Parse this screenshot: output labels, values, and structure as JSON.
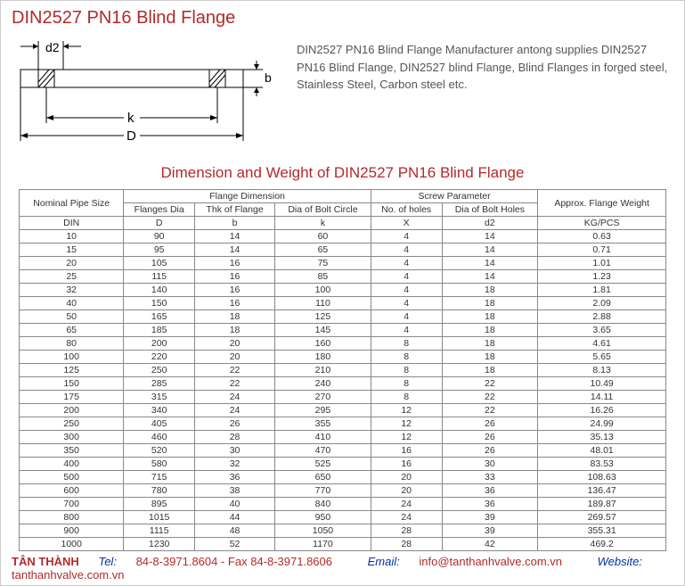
{
  "title": "DIN2527 PN16 Blind Flange",
  "description": "DIN2527 PN16 Blind Flange Manufacturer antong supplies DIN2527 PN16 Blind Flange, DIN2527 blind Flange, Blind Flanges in forged steel, Stainless Steel, Carbon steel etc.",
  "subheading": "Dimension and Weight of DIN2527 PN16 Blind Flange",
  "diagram": {
    "d2": "d2",
    "b": "b",
    "k": "k",
    "D": "D"
  },
  "table": {
    "hdr_npsize": "Nominal Pipe Size",
    "hdr_flangedim": "Flange Dimension",
    "hdr_screw": "Screw Parameter",
    "hdr_weight": "Approx. Flange Weight",
    "hdr_fdia": "Flanges Dia",
    "hdr_thk": "Thk of Flange",
    "hdr_boltcircle": "Dia of Bolt Circle",
    "hdr_noholes": "No. of holes",
    "hdr_diabolt": "Dia of Bolt Holes",
    "hdr_din": "DIN",
    "hdr_D": "D",
    "hdr_b": "b",
    "hdr_k": "k",
    "hdr_X": "X",
    "hdr_d2": "d2",
    "hdr_kgpcs": "KG/PCS",
    "rows": [
      [
        "10",
        "90",
        "14",
        "60",
        "4",
        "14",
        "0.63"
      ],
      [
        "15",
        "95",
        "14",
        "65",
        "4",
        "14",
        "0.71"
      ],
      [
        "20",
        "105",
        "16",
        "75",
        "4",
        "14",
        "1.01"
      ],
      [
        "25",
        "115",
        "16",
        "85",
        "4",
        "14",
        "1.23"
      ],
      [
        "32",
        "140",
        "16",
        "100",
        "4",
        "18",
        "1.81"
      ],
      [
        "40",
        "150",
        "16",
        "110",
        "4",
        "18",
        "2.09"
      ],
      [
        "50",
        "165",
        "18",
        "125",
        "4",
        "18",
        "2.88"
      ],
      [
        "65",
        "185",
        "18",
        "145",
        "4",
        "18",
        "3.65"
      ],
      [
        "80",
        "200",
        "20",
        "160",
        "8",
        "18",
        "4.61"
      ],
      [
        "100",
        "220",
        "20",
        "180",
        "8",
        "18",
        "5.65"
      ],
      [
        "125",
        "250",
        "22",
        "210",
        "8",
        "18",
        "8.13"
      ],
      [
        "150",
        "285",
        "22",
        "240",
        "8",
        "22",
        "10.49"
      ],
      [
        "175",
        "315",
        "24",
        "270",
        "8",
        "22",
        "14.11"
      ],
      [
        "200",
        "340",
        "24",
        "295",
        "12",
        "22",
        "16.26"
      ],
      [
        "250",
        "405",
        "26",
        "355",
        "12",
        "26",
        "24.99"
      ],
      [
        "300",
        "460",
        "28",
        "410",
        "12",
        "26",
        "35.13"
      ],
      [
        "350",
        "520",
        "30",
        "470",
        "16",
        "26",
        "48.01"
      ],
      [
        "400",
        "580",
        "32",
        "525",
        "16",
        "30",
        "83.53"
      ],
      [
        "500",
        "715",
        "36",
        "650",
        "20",
        "33",
        "108.63"
      ],
      [
        "600",
        "780",
        "38",
        "770",
        "20",
        "36",
        "136.47"
      ],
      [
        "700",
        "895",
        "40",
        "840",
        "24",
        "36",
        "189.87"
      ],
      [
        "800",
        "1015",
        "44",
        "950",
        "24",
        "39",
        "269.57"
      ],
      [
        "900",
        "1115",
        "48",
        "1050",
        "28",
        "39",
        "355.31"
      ],
      [
        "1000",
        "1230",
        "52",
        "1170",
        "28",
        "42",
        "469.2"
      ]
    ]
  },
  "footer": {
    "brand": "TÂN THÀNH",
    "tel_lbl": "Tel:",
    "tel": "84-8-3971.8604 - Fax 84-8-3971.8606",
    "email_lbl": "Email:",
    "email": "info@tanthanhvalve.com.vn",
    "web_lbl": "Website:",
    "web": "tanthanhvalve.com.vn"
  }
}
